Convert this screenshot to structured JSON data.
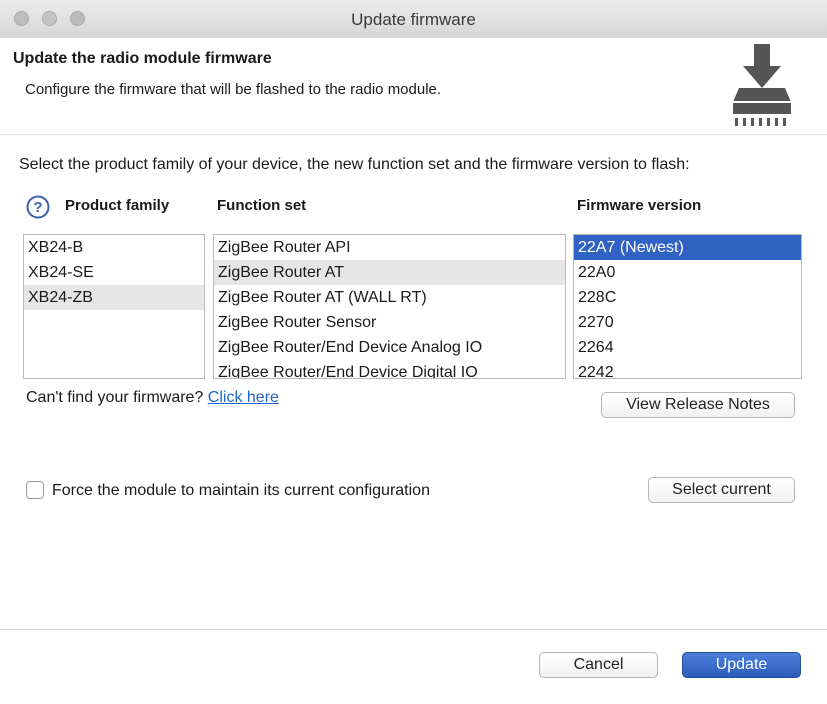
{
  "window": {
    "title": "Update firmware"
  },
  "header": {
    "title": "Update the radio module firmware",
    "description": "Configure the firmware that will be flashed to the radio module."
  },
  "instruction": "Select the product family of your device, the new function set and the firmware version to flash:",
  "columns": {
    "product_family": "Product family",
    "function_set": "Function set",
    "firmware_version": "Firmware version"
  },
  "product_family": {
    "items": [
      "XB24-B",
      "XB24-SE",
      "XB24-ZB"
    ],
    "selected": "XB24-ZB"
  },
  "function_set": {
    "items": [
      "ZigBee Router API",
      "ZigBee Router AT",
      "ZigBee Router AT (WALL RT)",
      "ZigBee Router Sensor",
      "ZigBee Router/End Device Analog IO",
      "ZigBee Router/End Device Digital IO"
    ],
    "selected": "ZigBee Router AT"
  },
  "firmware_version": {
    "items": [
      "22A7 (Newest)",
      "22A0",
      "228C",
      "2270",
      "2264",
      "2242"
    ],
    "selected": "22A7 (Newest)"
  },
  "help": {
    "cant_find": "Can't find your firmware?",
    "link": "Click here"
  },
  "buttons": {
    "view_release_notes": "View Release Notes",
    "select_current": "Select current",
    "cancel": "Cancel",
    "update": "Update"
  },
  "force_config": {
    "label": "Force the module to maintain its current configuration",
    "checked": false
  },
  "colors": {
    "accent": "#2f62c3",
    "link": "#2367c6",
    "selection_gray": "#e6e6e6"
  }
}
